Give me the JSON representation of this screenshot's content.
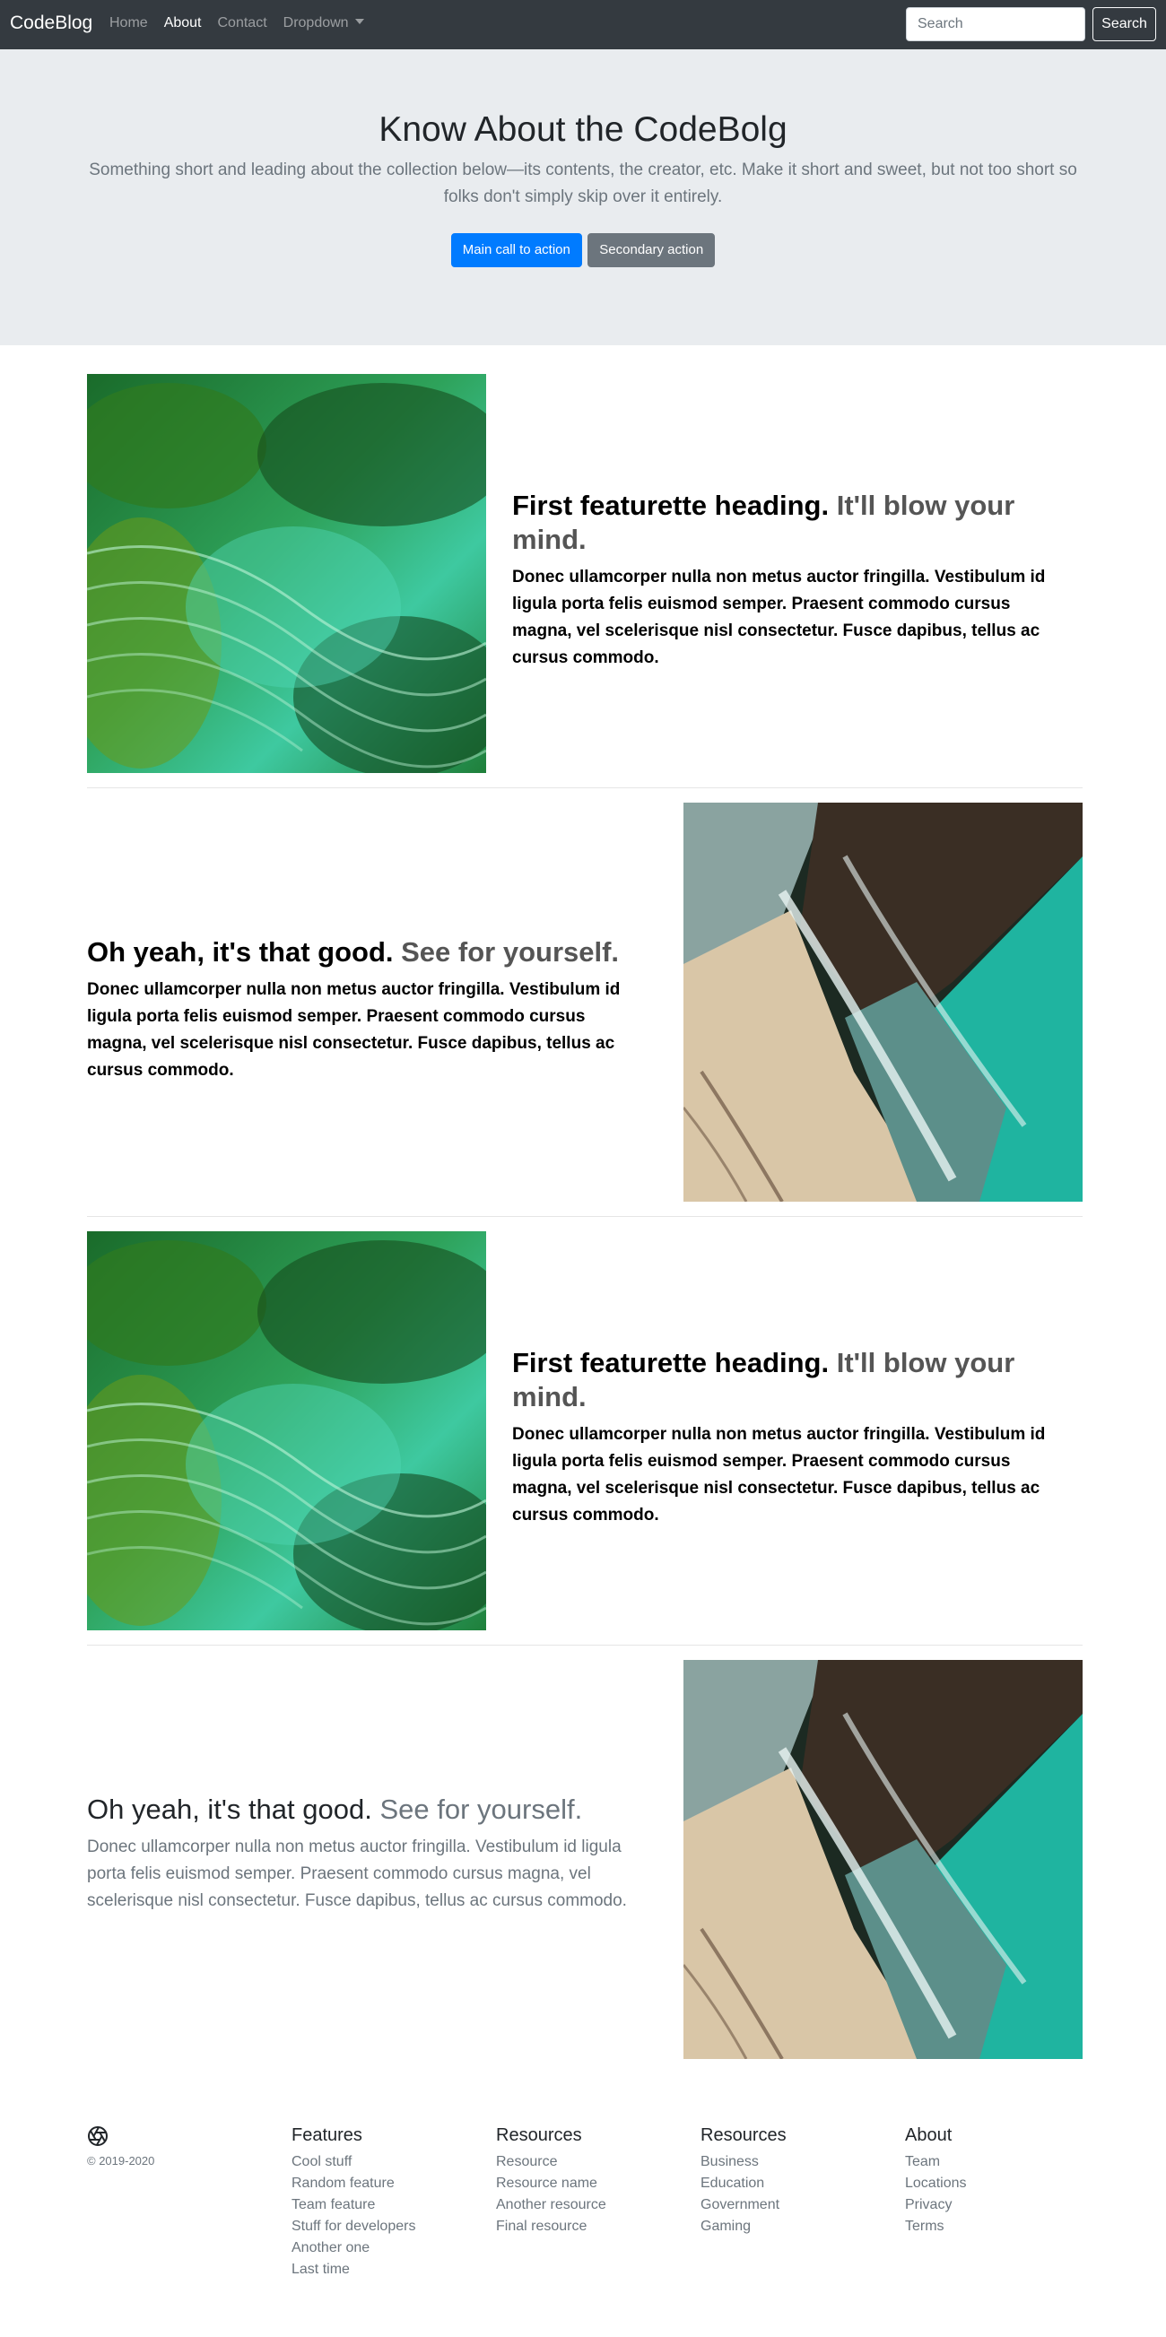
{
  "navbar": {
    "brand": "CodeBlog",
    "links": [
      "Home",
      "About",
      "Contact",
      "Dropdown"
    ],
    "search_placeholder": "Search",
    "search_button": "Search"
  },
  "hero": {
    "title": "Know About the CodeBolg",
    "lead": "Something short and leading about the collection below—its contents, the creator, etc. Make it short and sweet, but not too short so folks don't simply skip over it entirely.",
    "primary_button": "Main call to action",
    "secondary_button": "Secondary action"
  },
  "features": [
    {
      "heading": "First featurette heading.",
      "muted": "It'll blow your mind.",
      "body": "Donec ullamcorper nulla non metus auctor fringilla. Vestibulum id ligula porta felis euismod semper. Praesent commodo cursus magna, vel scelerisque nisl consectetur. Fusce dapibus, tellus ac cursus commodo."
    },
    {
      "heading": "Oh yeah, it's that good.",
      "muted": "See for yourself.",
      "body": "Donec ullamcorper nulla non metus auctor fringilla. Vestibulum id ligula porta felis euismod semper. Praesent commodo cursus magna, vel scelerisque nisl consectetur. Fusce dapibus, tellus ac cursus commodo."
    },
    {
      "heading": "First featurette heading.",
      "muted": "It'll blow your mind.",
      "body": "Donec ullamcorper nulla non metus auctor fringilla. Vestibulum id ligula porta felis euismod semper. Praesent commodo cursus magna, vel scelerisque nisl consectetur. Fusce dapibus, tellus ac cursus commodo."
    },
    {
      "heading": "Oh yeah, it's that good.",
      "muted": "See for yourself.",
      "body": "Donec ullamcorper nulla non metus auctor fringilla. Vestibulum id ligula porta felis euismod semper. Praesent commodo cursus magna, vel scelerisque nisl consectetur. Fusce dapibus, tellus ac cursus commodo."
    }
  ],
  "footer": {
    "copyright": "© 2019-2020",
    "columns": [
      {
        "title": "Features",
        "items": [
          "Cool stuff",
          "Random feature",
          "Team feature",
          "Stuff for developers",
          "Another one",
          "Last time"
        ]
      },
      {
        "title": "Resources",
        "items": [
          "Resource",
          "Resource name",
          "Another resource",
          "Final resource"
        ]
      },
      {
        "title": "Resources",
        "items": [
          "Business",
          "Education",
          "Government",
          "Gaming"
        ]
      },
      {
        "title": "About",
        "items": [
          "Team",
          "Locations",
          "Privacy",
          "Terms"
        ]
      }
    ]
  },
  "colors": {
    "navbar_bg": "#343a40",
    "jumbotron_bg": "#e9ecef",
    "primary": "#007bff",
    "secondary": "#6c757d"
  }
}
